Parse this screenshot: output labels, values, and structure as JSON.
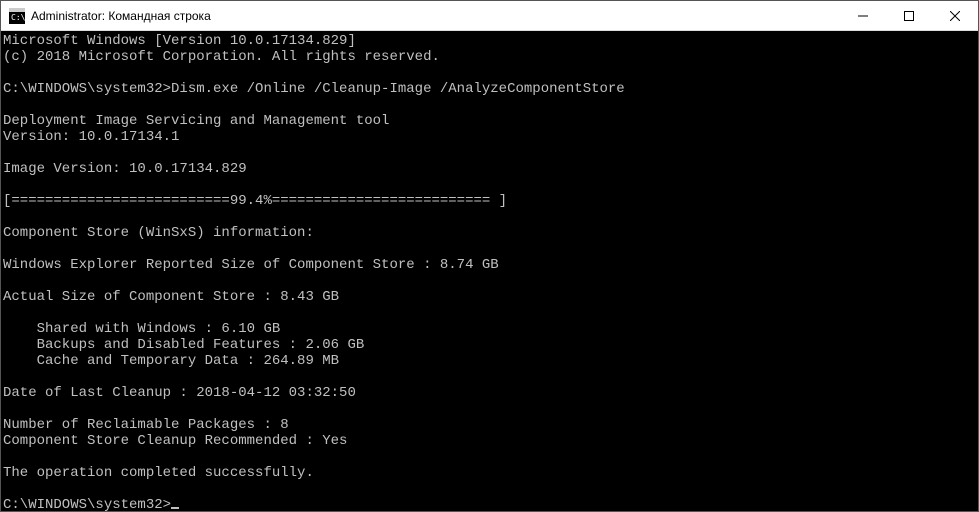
{
  "window": {
    "title": "Administrator: Командная строка"
  },
  "terminal": {
    "line1": "Microsoft Windows [Version 10.0.17134.829]",
    "line2": "(c) 2018 Microsoft Corporation. All rights reserved.",
    "blank1": "",
    "prompt1": "C:\\WINDOWS\\system32>Dism.exe /Online /Cleanup-Image /AnalyzeComponentStore",
    "blank2": "",
    "tool1": "Deployment Image Servicing and Management tool",
    "tool2": "Version: 10.0.17134.1",
    "blank3": "",
    "imgver": "Image Version: 10.0.17134.829",
    "blank4": "",
    "progress": "[==========================99.4%========================== ]",
    "blank5": "",
    "csinfo": "Component Store (WinSxS) information:",
    "blank6": "",
    "reported": "Windows Explorer Reported Size of Component Store : 8.74 GB",
    "blank7": "",
    "actual": "Actual Size of Component Store : 8.43 GB",
    "blank8": "",
    "shared": "    Shared with Windows : 6.10 GB",
    "backups": "    Backups and Disabled Features : 2.06 GB",
    "cache": "    Cache and Temporary Data : 264.89 MB",
    "blank9": "",
    "lastclean": "Date of Last Cleanup : 2018-04-12 03:32:50",
    "blank10": "",
    "reclaim": "Number of Reclaimable Packages : 8",
    "recommend": "Component Store Cleanup Recommended : Yes",
    "blank11": "",
    "success": "The operation completed successfully.",
    "blank12": "",
    "prompt2": "C:\\WINDOWS\\system32>"
  }
}
